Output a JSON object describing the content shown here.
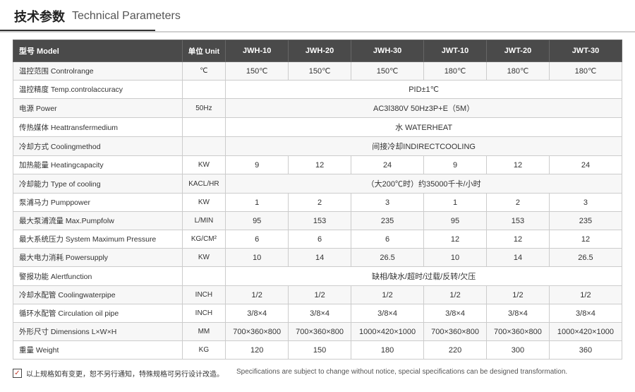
{
  "header": {
    "title_zh": "技术参数",
    "title_en": "Technical Parameters"
  },
  "table": {
    "columns": [
      {
        "key": "param",
        "label_zh": "型号 Model",
        "label_en": ""
      },
      {
        "key": "unit",
        "label_zh": "单位",
        "label_en": "Unit"
      },
      {
        "key": "jwh10",
        "label": "JWH-10"
      },
      {
        "key": "jwh20",
        "label": "JWH-20"
      },
      {
        "key": "jwh30",
        "label": "JWH-30"
      },
      {
        "key": "jwt10",
        "label": "JWT-10"
      },
      {
        "key": "jwt20",
        "label": "JWT-20"
      },
      {
        "key": "jwt30",
        "label": "JWT-30"
      }
    ],
    "rows": [
      {
        "param": "温控范围 Controlrange",
        "unit": "℃",
        "jwh10": "150℃",
        "jwh20": "150℃",
        "jwh30": "150℃",
        "jwt10": "180℃",
        "jwt20": "180℃",
        "jwt30": "180℃",
        "merged": false
      },
      {
        "param": "温控精度 Temp.controlaccuracy",
        "unit": "",
        "merged": true,
        "merged_value": "PID±1℃"
      },
      {
        "param": "电源 Power",
        "unit": "50Hz",
        "merged": true,
        "merged_value": "AC3ǀ380V 50Hz3P+E（5M）"
      },
      {
        "param": "传热媒体 Heattransfermedium",
        "unit": "",
        "merged": true,
        "merged_value": "水 WATERHEAT"
      },
      {
        "param": "冷却方式 Coolingmethod",
        "unit": "",
        "merged": true,
        "merged_value": "间接冷却INDIRECTCOOLING"
      },
      {
        "param": "加热能量 Heatingcapacity",
        "unit": "KW",
        "jwh10": "9",
        "jwh20": "12",
        "jwh30": "24",
        "jwt10": "9",
        "jwt20": "12",
        "jwt30": "24",
        "merged": false
      },
      {
        "param": "冷却能力 Type of cooling",
        "unit": "KACL/HR",
        "merged": true,
        "merged_value": "（大200℃时）约35000千卡/小时"
      },
      {
        "param": "泵浦马力 Pumppower",
        "unit": "KW",
        "jwh10": "1",
        "jwh20": "2",
        "jwh30": "3",
        "jwt10": "1",
        "jwt20": "2",
        "jwt30": "3",
        "merged": false
      },
      {
        "param": "最大泵浦流量 Max.Pumpfolw",
        "unit": "L/MIN",
        "jwh10": "95",
        "jwh20": "153",
        "jwh30": "235",
        "jwt10": "95",
        "jwt20": "153",
        "jwt30": "235",
        "merged": false
      },
      {
        "param": "最大系统压力 System Maximum Pressure",
        "unit": "KG/CM²",
        "jwh10": "6",
        "jwh20": "6",
        "jwh30": "6",
        "jwt10": "12",
        "jwt20": "12",
        "jwt30": "12",
        "merged": false
      },
      {
        "param": "最大电力消耗 Powersupply",
        "unit": "KW",
        "jwh10": "10",
        "jwh20": "14",
        "jwh30": "26.5",
        "jwt10": "10",
        "jwt20": "14",
        "jwt30": "26.5",
        "merged": false
      },
      {
        "param": "警报功能 Alertfunction",
        "unit": "",
        "merged": true,
        "merged_value": "缺相/缺水/超时/过载/反转/欠压"
      },
      {
        "param": "冷却水配管 Coolingwaterpipe",
        "unit": "INCH",
        "jwh10": "1/2",
        "jwh20": "1/2",
        "jwh30": "1/2",
        "jwt10": "1/2",
        "jwt20": "1/2",
        "jwt30": "1/2",
        "merged": false
      },
      {
        "param": "循环水配管 Circulation oil pipe",
        "unit": "INCH",
        "jwh10": "3/8×4",
        "jwh20": "3/8×4",
        "jwh30": "3/8×4",
        "jwt10": "3/8×4",
        "jwt20": "3/8×4",
        "jwt30": "3/8×4",
        "merged": false
      },
      {
        "param": "外形尺寸 Dimensions L×W×H",
        "unit": "MM",
        "jwh10": "700×360×800",
        "jwh20": "700×360×800",
        "jwh30": "1000×420×1000",
        "jwt10": "700×360×800",
        "jwt20": "700×360×800",
        "jwt30": "1000×420×1000",
        "merged": false
      },
      {
        "param": "重量 Weight",
        "unit": "KG",
        "jwh10": "120",
        "jwh20": "150",
        "jwh30": "180",
        "jwt10": "220",
        "jwt20": "300",
        "jwt30": "360",
        "merged": false
      }
    ]
  },
  "footer": {
    "note_zh": "以上规格如有变更，恕不另行通知，特殊规格可另行设计改造。",
    "note_en": "Specifications are subject to change without notice, special specifications can be designed transformation."
  }
}
